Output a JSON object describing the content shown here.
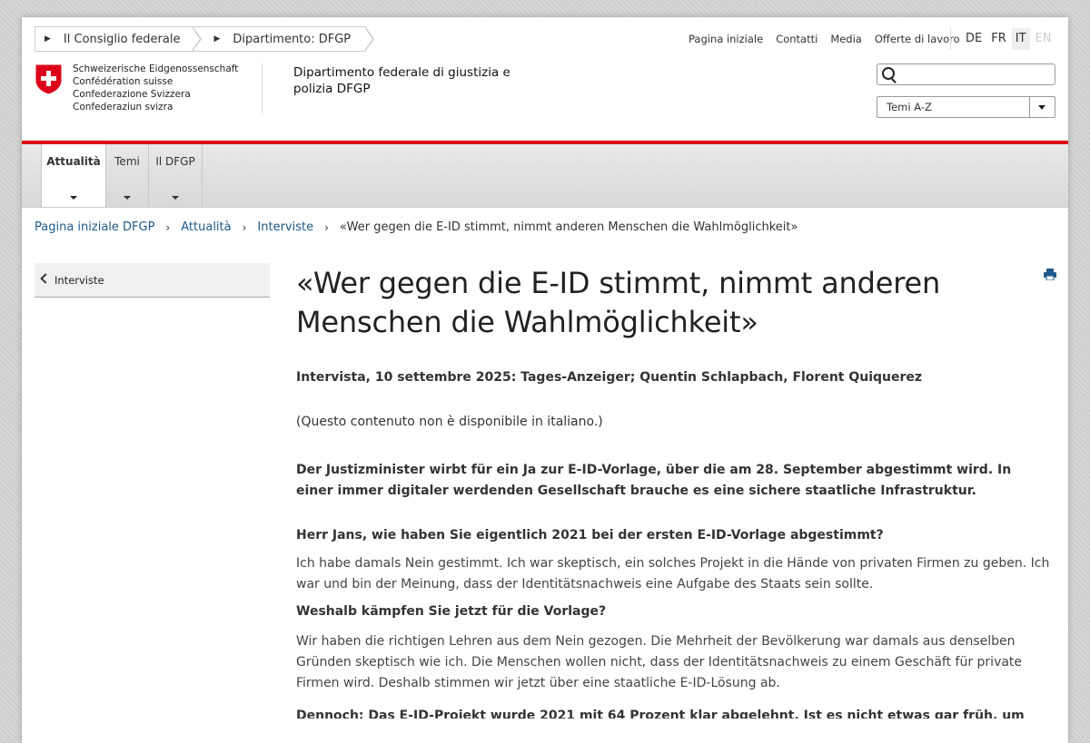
{
  "topcrumbs": [
    "Il Consiglio federale",
    "Dipartimento: DFGP"
  ],
  "meta_nav": [
    "Pagina iniziale",
    "Contatti",
    "Media",
    "Offerte di lavoro"
  ],
  "languages": [
    "DE",
    "FR",
    "IT",
    "EN"
  ],
  "logo_lines": [
    "Schweizerische Eidgenossenschaft",
    "Confédération suisse",
    "Confederazione Svizzera",
    "Confederaziun svizra"
  ],
  "department": "Dipartimento federale di giustizia e polizia DFGP",
  "search": {
    "placeholder": "",
    "value": ""
  },
  "select": {
    "value": "Temi A-Z"
  },
  "main_nav": [
    "Attualità",
    "Temi",
    "Il DFGP"
  ],
  "breadcrumb": {
    "links": [
      "Pagina iniziale DFGP",
      "Attualità",
      "Interviste"
    ],
    "current": "«Wer gegen die E-ID stimmt, nimmt anderen Menschen die Wahlmöglichkeit»"
  },
  "sidebar": {
    "back_label": "Interviste"
  },
  "article": {
    "title": "«Wer gegen die E-ID stimmt, nimmt anderen Menschen die Wahlmöglichkeit»",
    "lead": "Intervista, 10 settembre 2025: Tages-Anzeiger; Quentin Schlapbach, Florent Quiquerez",
    "note": "(Questo contenuto non è disponibile in italiano.)",
    "intro": "Der Justizminister wirbt für ein Ja zur E-ID-Vorlage, über die am 28. September abgestimmt wird. In einer immer digitaler werdenden Gesellschaft brauche es eine sichere staatliche Infrastruktur.",
    "q1": "Herr Jans, wie haben Sie eigentlich 2021 bei der ersten E-ID-Vorlage abgestimmt?",
    "a1": "Ich habe damals Nein gestimmt. Ich war skeptisch, ein solches Projekt in die Hände von privaten Firmen zu geben. Ich war und bin der Meinung, dass der Identitätsnachweis eine Aufgabe des Staats sein sollte.",
    "q2": "Weshalb kämpfen Sie jetzt für die Vorlage?",
    "a2": "Wir haben die richtigen Lehren aus dem Nein gezogen. Die Mehrheit der Bevölkerung war damals aus denselben Gründen skeptisch wie ich. Die Menschen wollen nicht, dass der Identitätsnachweis zu einem Geschäft für private Firmen wird. Deshalb stimmen wir jetzt über eine staatliche E-ID-Lösung ab.",
    "q3_partial": "Dennoch: Das E-ID-Projekt wurde 2021 mit 64 Prozent klar abgelehnt. Ist es nicht etwas gar früh, um erneut"
  },
  "colors": {
    "accent_red": "#dc0018",
    "link_blue": "#1f5a8a"
  }
}
